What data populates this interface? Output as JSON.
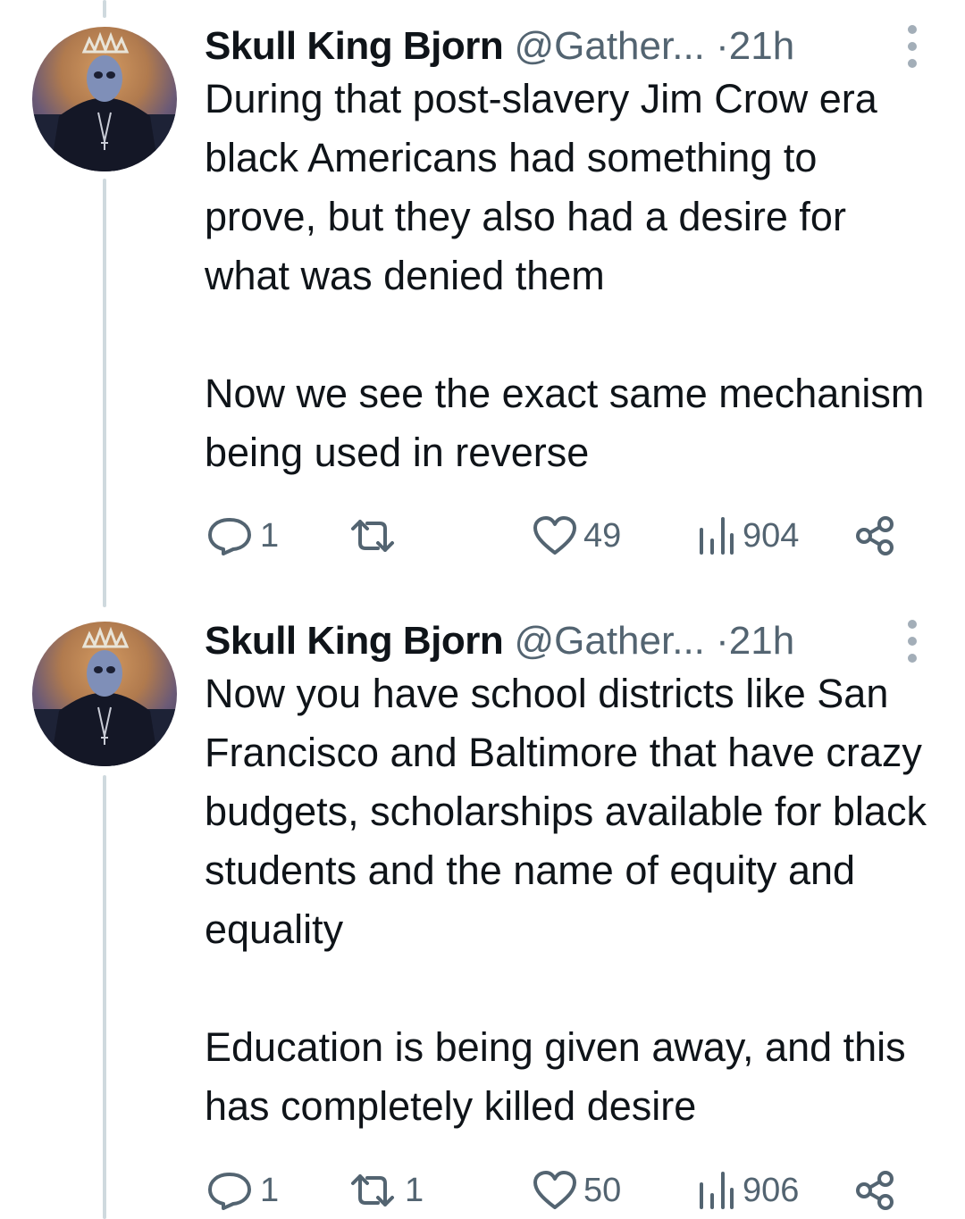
{
  "tweets": [
    {
      "author_name": "Skull King Bjorn",
      "handle": "@Gather...",
      "separator": "·",
      "time": "21h",
      "text": "During that post-slavery Jim Crow era black Americans had something to prove, but they also had a desire for what was denied them\n\nNow we see the exact same mechanism being used in reverse",
      "replies": "1",
      "retweets": "",
      "likes": "49",
      "views": "904"
    },
    {
      "author_name": "Skull King Bjorn",
      "handle": "@Gather...",
      "separator": "·",
      "time": "21h",
      "text": "Now you have school districts like San Francisco and Baltimore that have crazy budgets, scholarships available for black students and the name of equity and equality\n\nEducation is being given away, and this has completely killed desire",
      "replies": "1",
      "retweets": "1",
      "likes": "50",
      "views": "906"
    }
  ],
  "icons": {
    "reply": "reply-icon",
    "retweet": "retweet-icon",
    "like": "heart-icon",
    "views": "views-icon",
    "share": "share-icon",
    "more": "more-vertical-icon"
  },
  "colors": {
    "text": "#0f1419",
    "secondary": "#536471",
    "thread_line": "#cfd9de"
  }
}
